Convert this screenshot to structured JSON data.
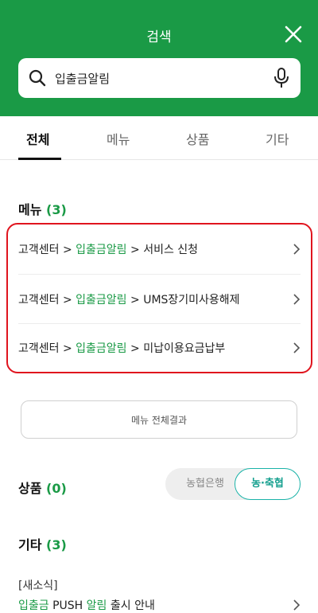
{
  "header": {
    "title": "검색"
  },
  "search": {
    "value": "입출금알림"
  },
  "tabs": [
    {
      "label": "전체",
      "active": true
    },
    {
      "label": "메뉴",
      "active": false
    },
    {
      "label": "상품",
      "active": false
    },
    {
      "label": "기타",
      "active": false
    }
  ],
  "menu_section": {
    "title": "메뉴",
    "count": "(3)",
    "items": [
      {
        "prefix": "고객센터 > ",
        "highlight": "입출금알림",
        "suffix": " > 서비스 신청"
      },
      {
        "prefix": "고객센터 > ",
        "highlight": "입출금알림",
        "suffix": " > UMS장기미사용해제"
      },
      {
        "prefix": "고객센터 > ",
        "highlight": "입출금알림",
        "suffix": " > 미납이용요금납부"
      }
    ],
    "all_results_label": "메뉴 전체결과"
  },
  "product_section": {
    "title": "상품",
    "count": "(0)",
    "toggle": {
      "option1": "농협은행",
      "option2": "농·축협",
      "selected": "농·축협"
    }
  },
  "etc_section": {
    "title": "기타",
    "count": "(3)",
    "news": {
      "category": "[새소식]",
      "parts": [
        "입출금",
        " PUSH ",
        "알림",
        " 출시 안내"
      ]
    }
  },
  "colors": {
    "brand_green": "#1a9a46",
    "highlight_red": "#e0141e",
    "toggle_teal": "#16a08f"
  }
}
